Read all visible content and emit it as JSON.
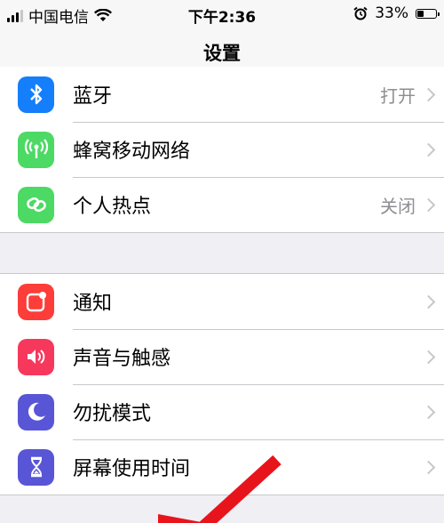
{
  "status_bar": {
    "carrier": "中国电信",
    "time": "下午2:36",
    "battery": "33%",
    "battery_level": 0.33
  },
  "nav": {
    "title": "设置"
  },
  "groups": [
    {
      "items": [
        {
          "label": "蓝牙",
          "value": "打开",
          "icon": "bluetooth-icon",
          "color": "#147efb"
        },
        {
          "label": "蜂窝移动网络",
          "value": "",
          "icon": "antenna-icon",
          "color": "#4cd964"
        },
        {
          "label": "个人热点",
          "value": "关闭",
          "icon": "hotspot-link-icon",
          "color": "#4cd964"
        }
      ]
    },
    {
      "items": [
        {
          "label": "通知",
          "value": "",
          "icon": "notification-icon",
          "color": "#fc3d39"
        },
        {
          "label": "声音与触感",
          "value": "",
          "icon": "speaker-icon",
          "color": "#f7385d"
        },
        {
          "label": "勿扰模式",
          "value": "",
          "icon": "moon-icon",
          "color": "#5856d6"
        },
        {
          "label": "屏幕使用时间",
          "value": "",
          "icon": "hourglass-icon",
          "color": "#5856d6"
        }
      ]
    }
  ],
  "overlay": {
    "arrow_color": "#e8141c"
  }
}
